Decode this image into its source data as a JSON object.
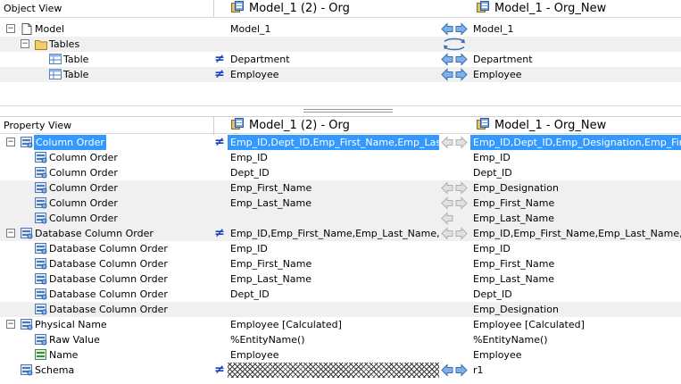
{
  "object_view": {
    "header": {
      "col1": "Object View",
      "col2": "Model_1 (2) - Org",
      "col3": "Model_1 - Org_New"
    },
    "rows": [
      {
        "label": "Model",
        "left": "Model_1",
        "right": "Model_1",
        "icon": "document-icon"
      },
      {
        "label": "Tables",
        "left": "",
        "right": "",
        "icon": "folder-icon"
      },
      {
        "label": "Table",
        "left": "Department",
        "right": "Department",
        "icon": "table-icon"
      },
      {
        "label": "Table",
        "left": "Employee",
        "right": "Employee",
        "icon": "table-icon"
      }
    ]
  },
  "property_view": {
    "header": {
      "col1": "Property View",
      "col2": "Model_1 (2) - Org",
      "col3": "Model_1 - Org_New"
    },
    "rows": [
      {
        "label": "Column Order",
        "left": "Emp_ID,Dept_ID,Emp_First_Name,Emp_Last...",
        "right": "Emp_ID,Dept_ID,Emp_Designation,Emp_Firs..."
      },
      {
        "label": "Column Order",
        "left": "Emp_ID",
        "right": "Emp_ID"
      },
      {
        "label": "Column Order",
        "left": "Dept_ID",
        "right": "Dept_ID"
      },
      {
        "label": "Column Order",
        "left": "Emp_First_Name",
        "right": "Emp_Designation"
      },
      {
        "label": "Column Order",
        "left": "Emp_Last_Name",
        "right": "Emp_First_Name"
      },
      {
        "label": "Column Order",
        "left": "",
        "right": "Emp_Last_Name"
      },
      {
        "label": "Database Column Order",
        "left": "Emp_ID,Emp_First_Name,Emp_Last_Name,D...",
        "right": "Emp_ID,Emp_First_Name,Emp_Last_Name,D..."
      },
      {
        "label": "Database Column Order",
        "left": "Emp_ID",
        "right": "Emp_ID"
      },
      {
        "label": "Database Column Order",
        "left": "Emp_First_Name",
        "right": "Emp_First_Name"
      },
      {
        "label": "Database Column Order",
        "left": "Emp_Last_Name",
        "right": "Emp_Last_Name"
      },
      {
        "label": "Database Column Order",
        "left": "Dept_ID",
        "right": "Dept_ID"
      },
      {
        "label": "Database Column Order",
        "left": "",
        "right": "Emp_Designation"
      },
      {
        "label": "Physical Name",
        "left": "Employee [Calculated]",
        "right": "Employee [Calculated]"
      },
      {
        "label": "Raw Value",
        "left": "%EntityName()",
        "right": "%EntityName()"
      },
      {
        "label": "Name",
        "left": "Employee",
        "right": "Employee"
      },
      {
        "label": "Schema",
        "left": "",
        "right": "r1"
      }
    ]
  },
  "symbols": {
    "not_equal": "≠",
    "expanded": "−"
  }
}
